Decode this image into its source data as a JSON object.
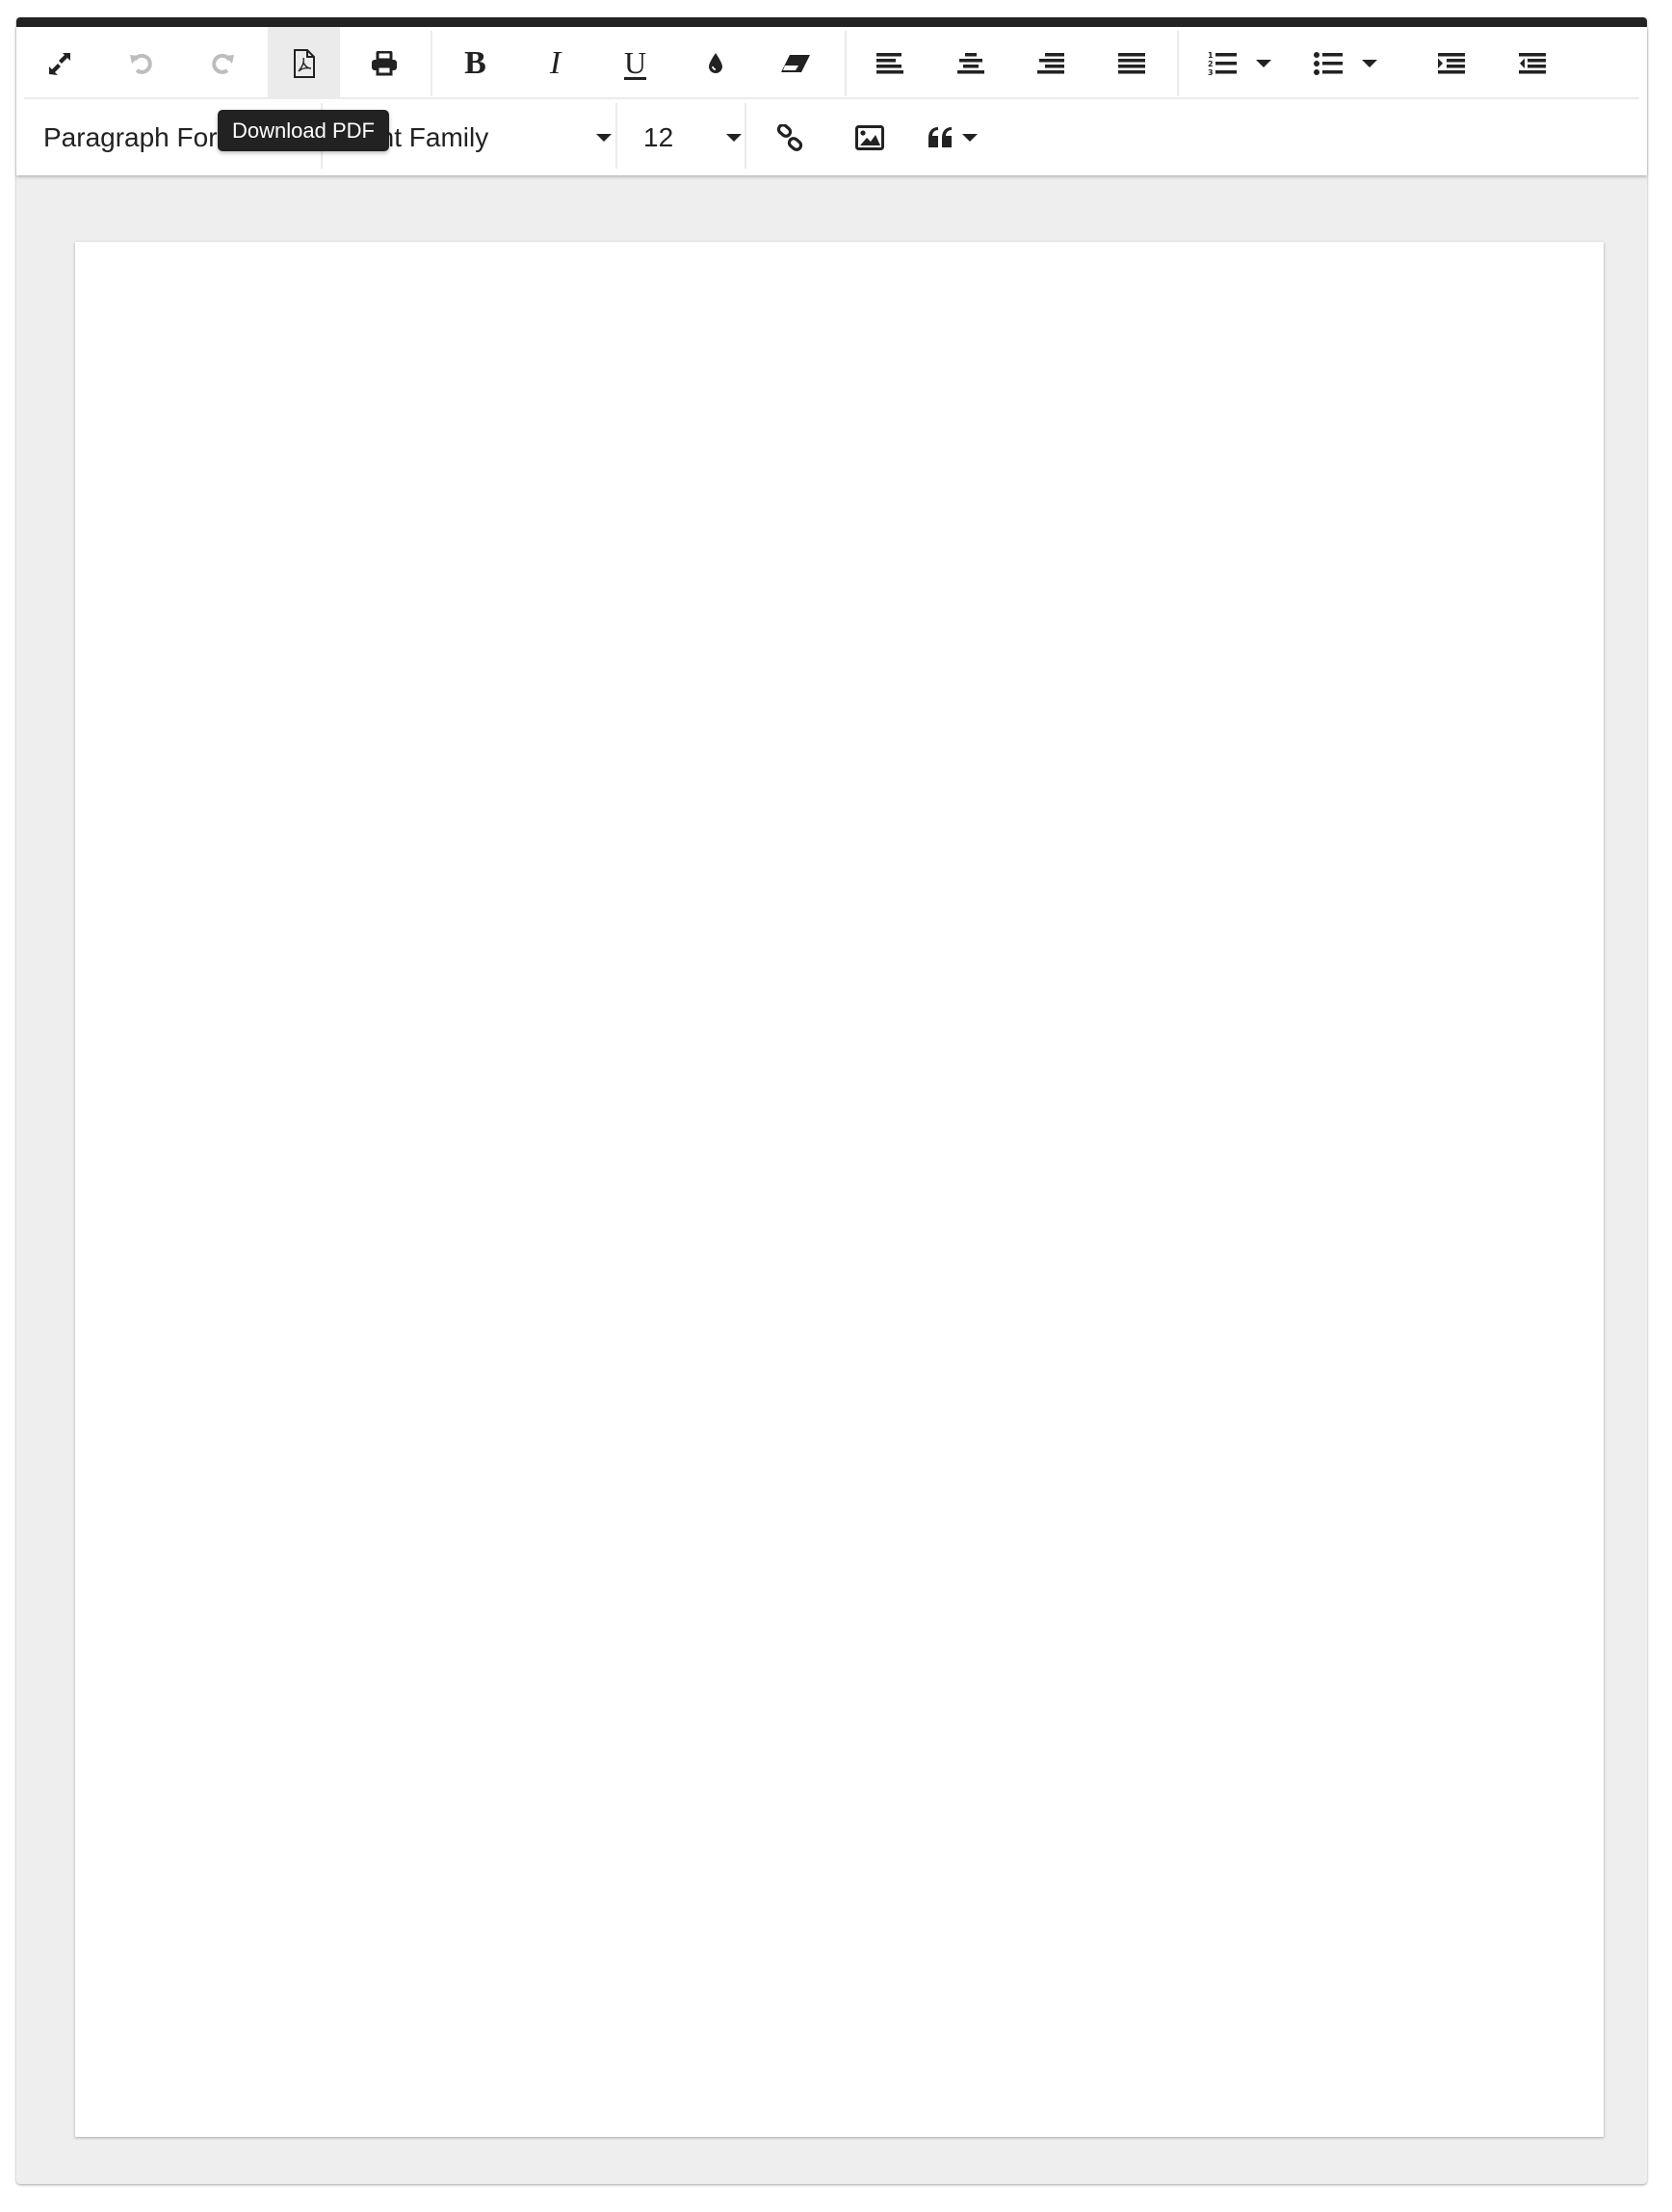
{
  "toolbar": {
    "row1": {
      "fullscreen": {
        "label": "Fullscreen",
        "icon": "expand-icon"
      },
      "undo": {
        "label": "Undo",
        "icon": "undo-icon",
        "disabled": true
      },
      "redo": {
        "label": "Redo",
        "icon": "redo-icon",
        "disabled": true
      },
      "download_pdf": {
        "label": "Download PDF",
        "icon": "file-pdf-icon",
        "hovered": true
      },
      "print": {
        "label": "Print",
        "icon": "print-icon"
      },
      "bold": {
        "label": "Bold",
        "glyph": "B"
      },
      "italic": {
        "label": "Italic",
        "glyph": "I"
      },
      "underline": {
        "label": "Underline",
        "glyph": "U"
      },
      "text_color": {
        "label": "Text Color",
        "icon": "tint-icon"
      },
      "clear_formatting": {
        "label": "Clear Formatting",
        "icon": "eraser-icon"
      },
      "align_left": {
        "label": "Align Left",
        "icon": "align-left-icon"
      },
      "align_center": {
        "label": "Align Center",
        "icon": "align-center-icon"
      },
      "align_right": {
        "label": "Align Right",
        "icon": "align-right-icon"
      },
      "align_justify": {
        "label": "Align Justify",
        "icon": "align-justify-icon"
      },
      "ordered_list": {
        "label": "Ordered List",
        "icon": "list-ol-icon"
      },
      "unordered_list": {
        "label": "Unordered List",
        "icon": "list-ul-icon"
      },
      "indent": {
        "label": "Increase Indent",
        "icon": "indent-icon"
      },
      "outdent": {
        "label": "Decrease Indent",
        "icon": "outdent-icon"
      }
    },
    "row2": {
      "paragraph_format": {
        "value": "Paragraph Format"
      },
      "font_family": {
        "value": "Font Family"
      },
      "font_size": {
        "value": "12"
      },
      "insert_link": {
        "label": "Insert Link",
        "icon": "link-icon"
      },
      "insert_image": {
        "label": "Insert Image",
        "icon": "image-icon"
      },
      "quote": {
        "label": "Quote",
        "icon": "quote-left-icon"
      }
    }
  },
  "tooltip": {
    "text": "Download PDF"
  },
  "document": {
    "content": ""
  },
  "colors": {
    "top_bar": "#222222",
    "icon": "#222222",
    "icon_disabled": "#bdbdbd",
    "hover_bg": "#ebebeb",
    "canvas_bg": "#eeeeee",
    "page_bg": "#ffffff"
  }
}
